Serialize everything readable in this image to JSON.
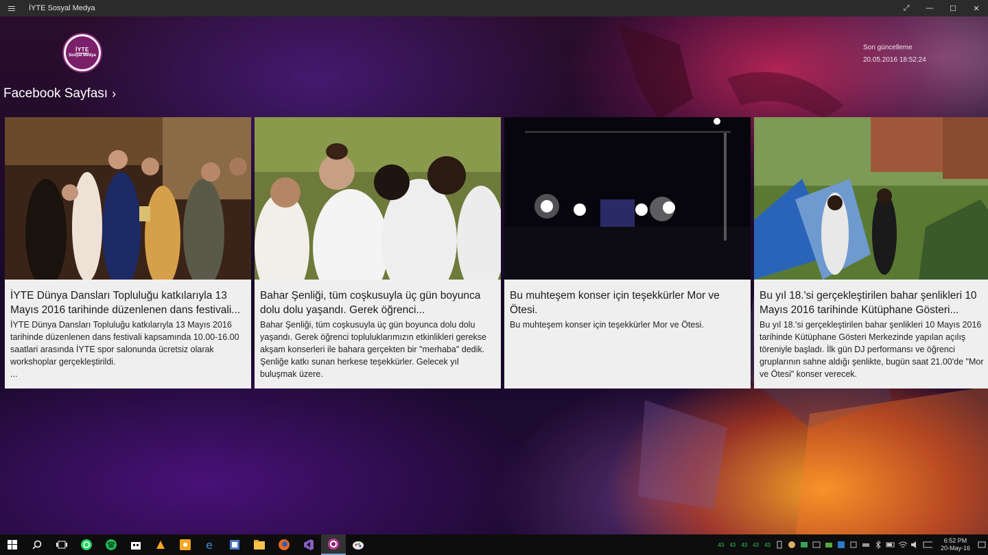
{
  "window": {
    "title": "İYTE Sosyal Medya",
    "min": "—",
    "max": "☐",
    "close": "✕",
    "fullscreen": "⤢"
  },
  "header": {
    "logo_line1": "İYTE",
    "logo_line2": "Sosyal Medya",
    "facebook_link": "Facebook Sayfası",
    "update_label": "Son güncelleme",
    "update_value": "20.05.2016 18:52:24"
  },
  "cards": [
    {
      "title": "İYTE Dünya Dansları Topluluğu katkılarıyla 13 Mayıs 2016 tarihinde düzenlenen dans festivali...",
      "text": "İYTE Dünya Dansları Topluluğu katkılarıyla 13 Mayıs 2016 tarihinde düzenlenen dans festivali kapsamında 10.00-16.00 saatlari arasında İYTE spor salonunda ücretsiz olarak workshoplar gerçekleştirildi.",
      "more": "..."
    },
    {
      "title": "Bahar Şenliği, tüm coşkusuyla üç gün boyunca dolu dolu yaşandı. Gerek öğrenci...",
      "text": "Bahar Şenliği, tüm coşkusuyla üç gün boyunca dolu dolu yaşandı. Gerek öğrenci topluluklarımızın etkinlikleri gerekse akşam konserleri ile bahara gerçekten bir \"merhaba\" dedik. Şenliğe katkı sunan herkese teşekkürler. Gelecek yıl buluşmak üzere."
    },
    {
      "title": "Bu muhteşem konser için teşekkürler Mor ve Ötesi.",
      "text": "Bu muhteşem konser için teşekkürler Mor ve Ötesi."
    },
    {
      "title": "Bu yıl 18.'si gerçekleştirilen bahar şenlikleri 10 Mayıs 2016 tarihinde Kütüphane Gösteri...",
      "text": "Bu yıl 18.'si gerçekleştirilen bahar şenlikleri 10 Mayıs 2016 tarihinde Kütüphane Gösteri Merkezinde yapılan açılış töreniyle başladı. İlk gün DJ performansı ve öğrenci gruplarının sahne aldığı şenlikte, bugün saat 21.00'de \"Mor ve Ötesi\" konser verecek."
    }
  ],
  "taskbar": {
    "tray_numbers": [
      "43",
      "43",
      "43",
      "43",
      "43"
    ],
    "time": "6:52 PM",
    "date": "20-May-16"
  },
  "colors": {
    "accent": "#7c1f6a",
    "card_bg": "#efefef",
    "titlebar": "#2b2b2b"
  }
}
